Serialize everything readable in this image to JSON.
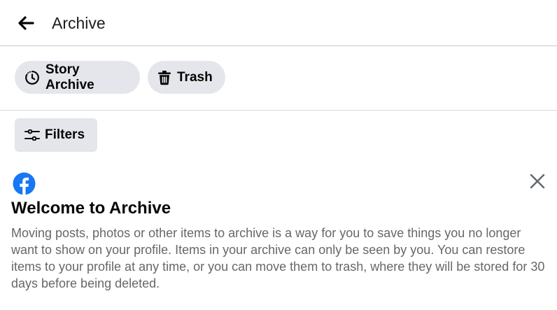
{
  "header": {
    "back_icon": "arrow-left-icon",
    "title": "Archive"
  },
  "chips": {
    "story_archive": {
      "label": "Story Archive",
      "icon": "clock-icon"
    },
    "trash": {
      "label": "Trash",
      "icon": "trash-icon"
    }
  },
  "filters": {
    "label": "Filters",
    "icon": "sliders-icon"
  },
  "welcome": {
    "logo": "facebook-icon",
    "close_icon": "close-icon",
    "title": "Welcome to Archive",
    "body": "Moving posts, photos or other items to archive is a way for you to save things you no longer want to show on your profile. Items in your archive can only be seen by you. You can restore items to your profile at any time, or you can move them to trash, where they will be stored for 30 days before being deleted."
  },
  "colors": {
    "facebook_blue": "#1877f2",
    "chip_background": "#e4e6eb",
    "secondary_text": "#65676b",
    "primary_text": "#050505"
  }
}
